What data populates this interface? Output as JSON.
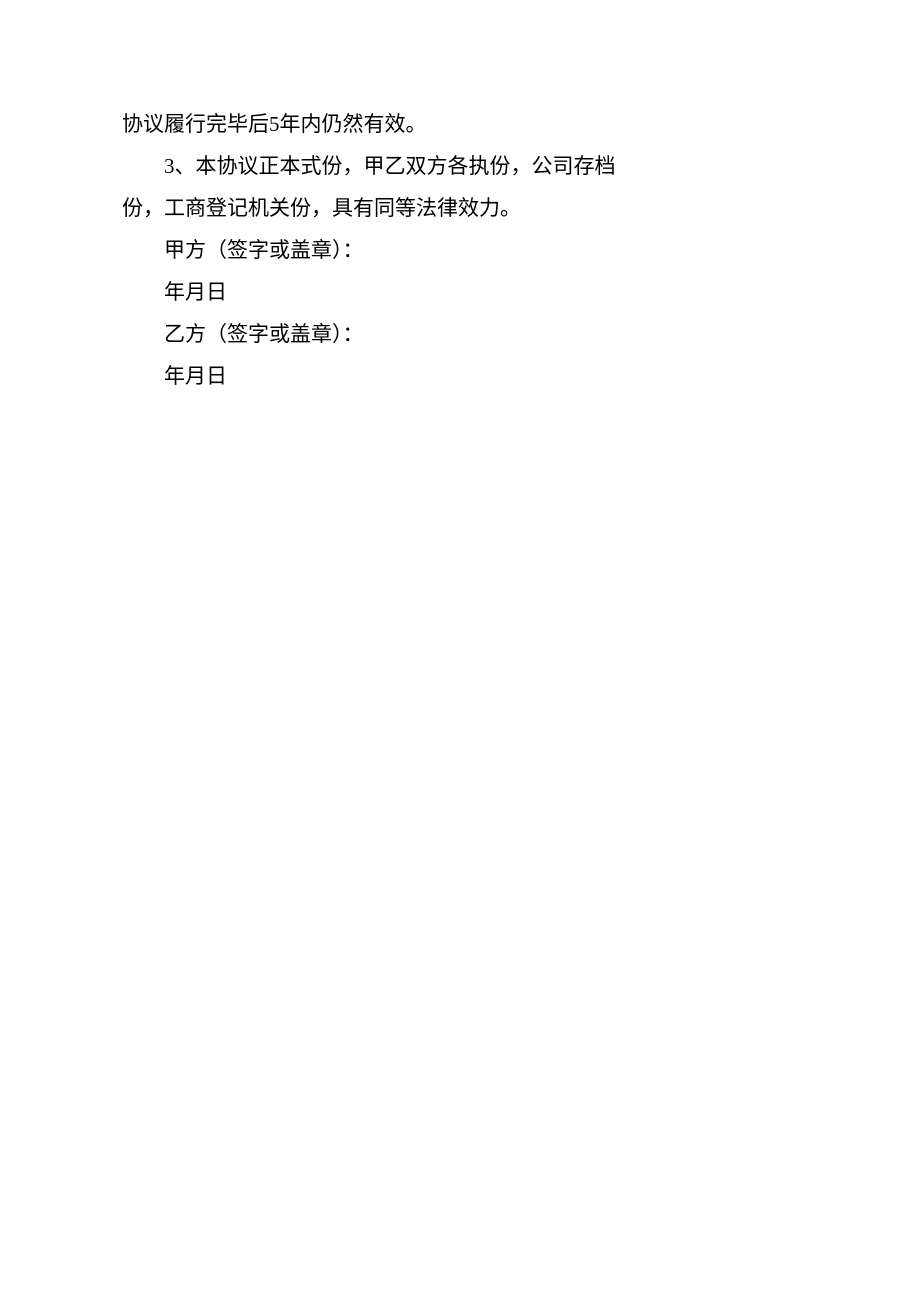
{
  "content": {
    "line1": "协议履行完毕后5年内仍然有效。",
    "line2": "3、本协议正本式份，甲乙双方各执份，公司存档",
    "line3": "份，工商登记机关份，具有同等法律效力。",
    "line4": "甲方（签字或盖章）：",
    "line5": "年月日",
    "line6": "乙方（签字或盖章）：",
    "line7": "年月日"
  }
}
